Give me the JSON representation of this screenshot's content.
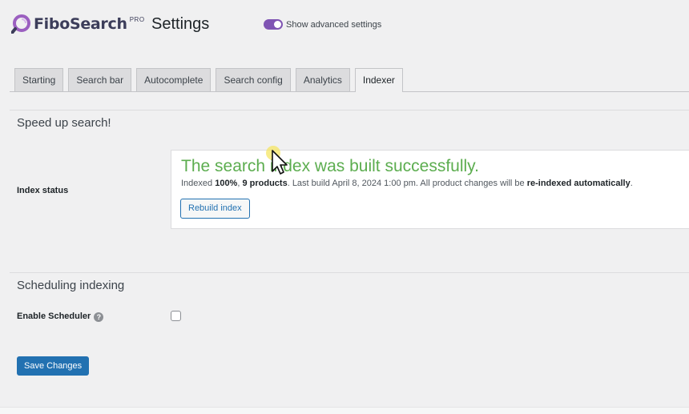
{
  "header": {
    "logo_text": "FiboSearch",
    "logo_badge": "PRO",
    "title": "Settings",
    "advanced_toggle": {
      "label": "Show advanced settings",
      "on": true
    }
  },
  "tabs": [
    {
      "label": "Starting",
      "active": false
    },
    {
      "label": "Search bar",
      "active": false
    },
    {
      "label": "Autocomplete",
      "active": false
    },
    {
      "label": "Search config",
      "active": false
    },
    {
      "label": "Analytics",
      "active": false
    },
    {
      "label": "Indexer",
      "active": true
    }
  ],
  "sections": {
    "speed": {
      "title": "Speed up search!",
      "index_status_label": "Index status",
      "status": {
        "headline": "The search index was built successfully.",
        "detail_prefix": "Indexed ",
        "percent": "100%",
        "sep": ", ",
        "products": "9 products",
        "detail_mid": ". Last build April 8, 2024 1:00 pm. All product changes will be ",
        "reindexed": "re-indexed automatically",
        "detail_end": ".",
        "rebuild_label": "Rebuild index"
      }
    },
    "scheduling": {
      "title": "Scheduling indexing",
      "scheduler_label": "Enable Scheduler",
      "help_glyph": "?",
      "scheduler_enabled": false
    }
  },
  "footer": {
    "save_label": "Save Changes"
  },
  "colors": {
    "accent_purple": "#7f54b3",
    "wp_blue": "#2271b1",
    "success_green": "#5cad4f"
  },
  "icons": {
    "logo": "fibosearch-logo-icon",
    "help": "help-question-icon",
    "cursor": "mouse-cursor-icon"
  }
}
